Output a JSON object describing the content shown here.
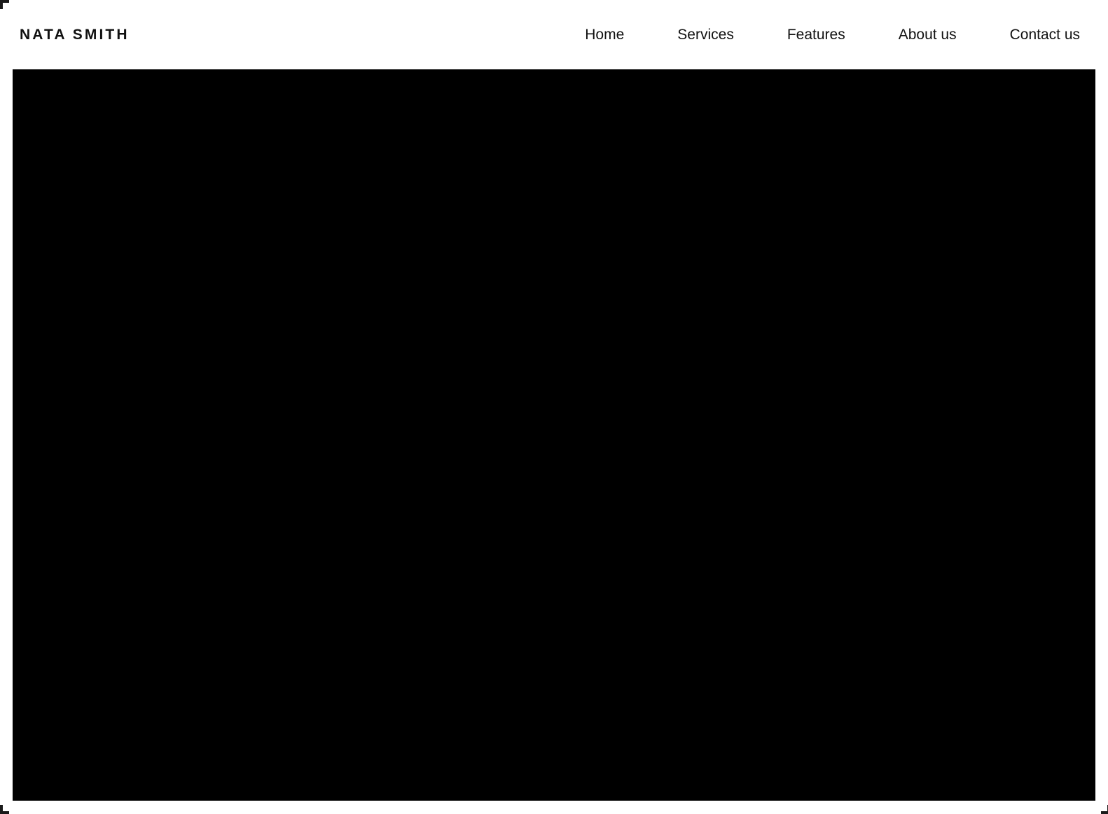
{
  "site": {
    "brand": "NATA SMITH",
    "background_color": "#ffffff",
    "text_color": "#111111"
  },
  "header": {
    "nav": [
      {
        "label": "Home"
      },
      {
        "label": "Services"
      },
      {
        "label": "Features"
      },
      {
        "label": "About us"
      },
      {
        "label": "Contact us"
      }
    ]
  },
  "hero": {
    "media_label": "",
    "background_color": "#000000"
  }
}
